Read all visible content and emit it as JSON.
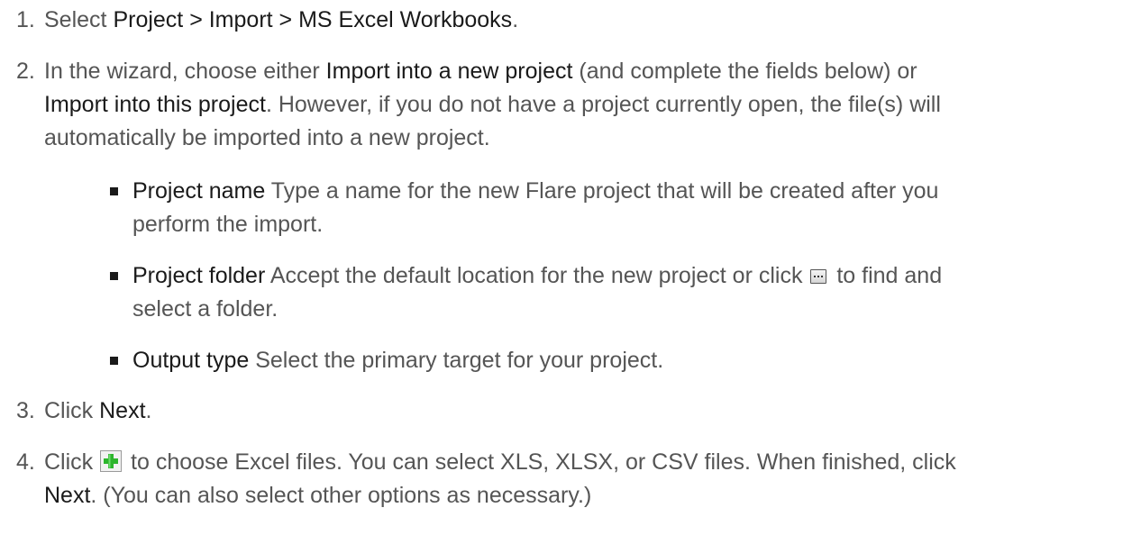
{
  "steps": [
    {
      "number": "1.",
      "text_1": "Select ",
      "ui_1": "Project > Import > MS Excel Workbooks",
      "text_2": "."
    },
    {
      "number": "2.",
      "text_1": "In the wizard, choose either ",
      "ui_1": "Import into a new project",
      "text_2": " (and complete the fields below) or",
      "ui_2": "Import into this project",
      "text_3": ". However, if you do not have a project currently open, the file(s) will",
      "text_4": "automatically be imported into a new project.",
      "bullets": [
        {
          "term": "Project name",
          "text_1": " Type a name for the new Flare project that will be created after you",
          "text_2": "perform the import."
        },
        {
          "term": "Project folder",
          "text_1": " Accept the default location for the new project or click ",
          "icon": "browse-button-icon",
          "text_2": " to find and",
          "text_3": "select a folder."
        },
        {
          "term": "Output type",
          "text_1": " Select the primary target for your project."
        }
      ]
    },
    {
      "number": "3.",
      "text_1": "Click ",
      "ui_1": "Next",
      "text_2": "."
    },
    {
      "number": "4.",
      "text_1": "Click ",
      "icon": "green-plus-add-icon",
      "text_2": " to choose Excel files. You can select XLS, XLSX, or CSV files. When finished, click",
      "ui_1": "Next",
      "text_3": ". (You can also select other options as necessary.)"
    }
  ],
  "colors": {
    "body_text": "#555555",
    "ui_text": "#1a1a1a",
    "add_icon_green": "#2db52d"
  }
}
